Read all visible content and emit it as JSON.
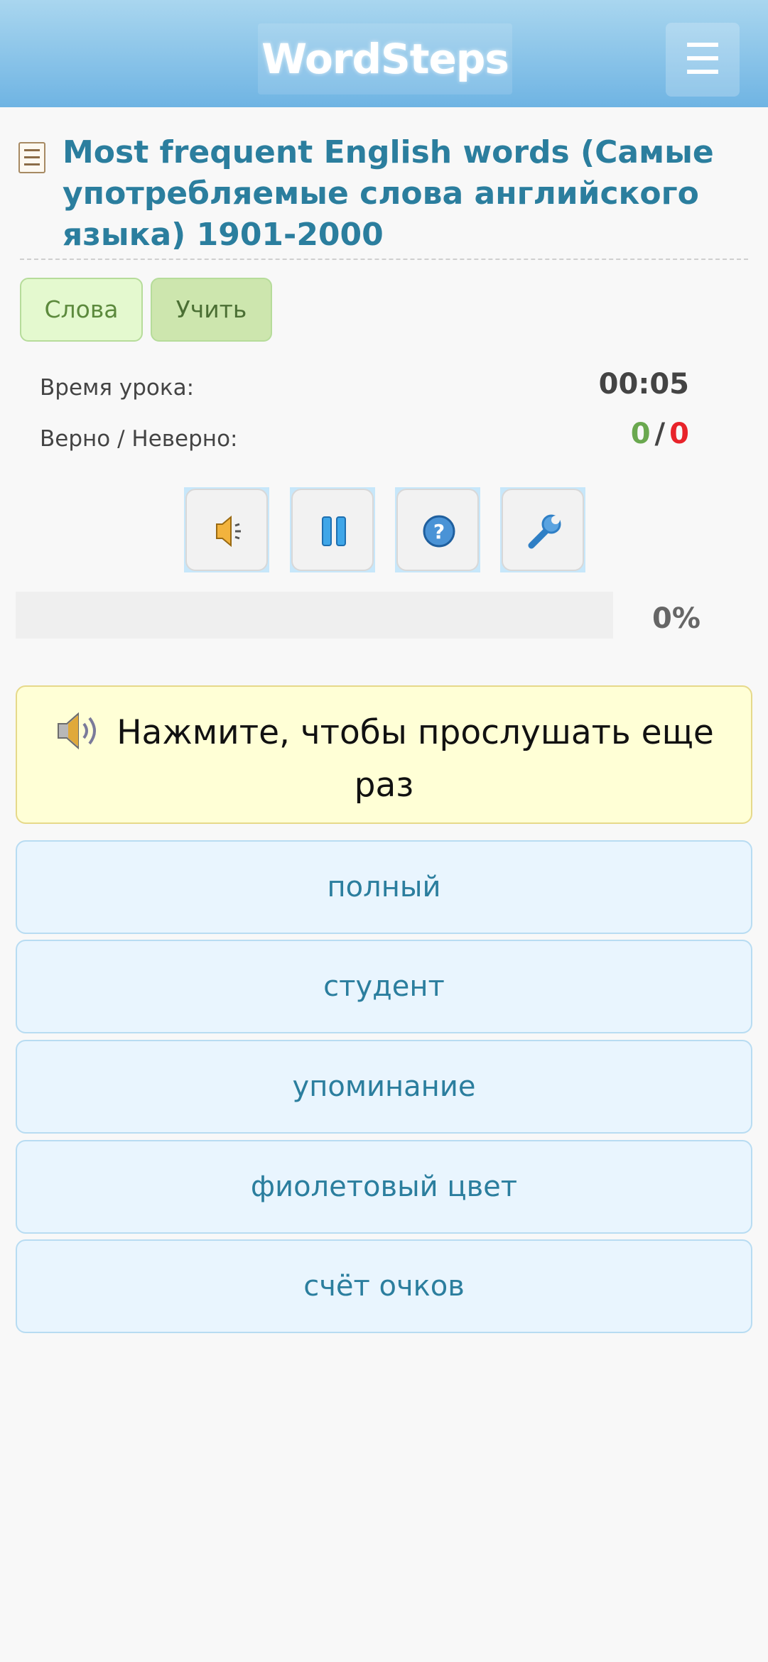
{
  "header": {
    "logo_text": "WordSteps",
    "menu_icon": "hamburger-icon",
    "menu_glyph": "☰"
  },
  "title": {
    "icon": "list-icon",
    "text": "Most frequent English words (Самые употребляемые слова английского языка) 1901-2000"
  },
  "tabs": [
    {
      "label": "Слова"
    },
    {
      "label": "Учить"
    }
  ],
  "stats": {
    "time_label": "Время урока:",
    "time_value": "00:05",
    "score_label": "Верно / Неверно:",
    "correct": "0",
    "separator": "/",
    "incorrect": "0"
  },
  "controls": [
    {
      "icon": "speaker-icon"
    },
    {
      "icon": "pause-icon"
    },
    {
      "icon": "help-icon"
    },
    {
      "icon": "wrench-icon"
    }
  ],
  "progress": {
    "percent": 0,
    "label": "0%"
  },
  "prompt": {
    "icon": "speaker-icon",
    "text": "Нажмите, чтобы прослушать еще раз"
  },
  "answers": [
    {
      "label": "полный"
    },
    {
      "label": "студент"
    },
    {
      "label": "упоминание"
    },
    {
      "label": "фиолетовый цвет"
    },
    {
      "label": "счёт очков"
    }
  ],
  "colors": {
    "accent": "#2b7e9e",
    "correct": "#6aa84f",
    "incorrect": "#e8232a"
  }
}
